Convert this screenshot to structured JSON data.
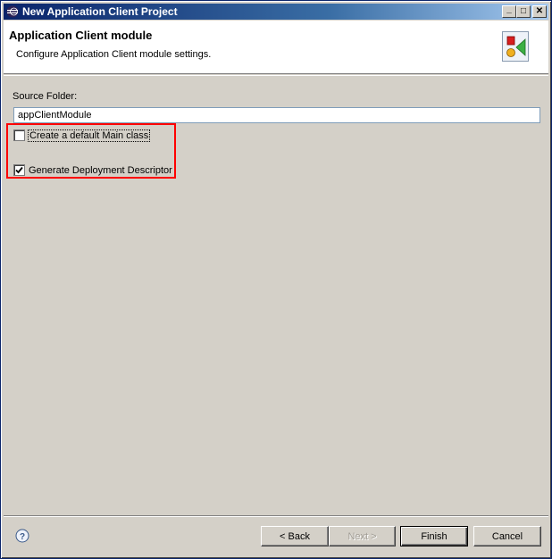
{
  "window": {
    "title": "New Application Client Project",
    "minimize_label": "_",
    "maximize_label": "□",
    "close_label": "✕"
  },
  "banner": {
    "title": "Application Client module",
    "description": "Configure Application Client module settings."
  },
  "form": {
    "source_folder_label": "Source Folder:",
    "source_folder_value": "appClientModule",
    "create_main_label": "Create a default Main class",
    "create_main_checked": false,
    "generate_dd_label": "Generate Deployment Descriptor",
    "generate_dd_checked": true
  },
  "buttons": {
    "back": "< Back",
    "next": "Next >",
    "finish": "Finish",
    "cancel": "Cancel"
  },
  "colors": {
    "highlight": "#ff0000",
    "titlebar": "#0a246a"
  }
}
